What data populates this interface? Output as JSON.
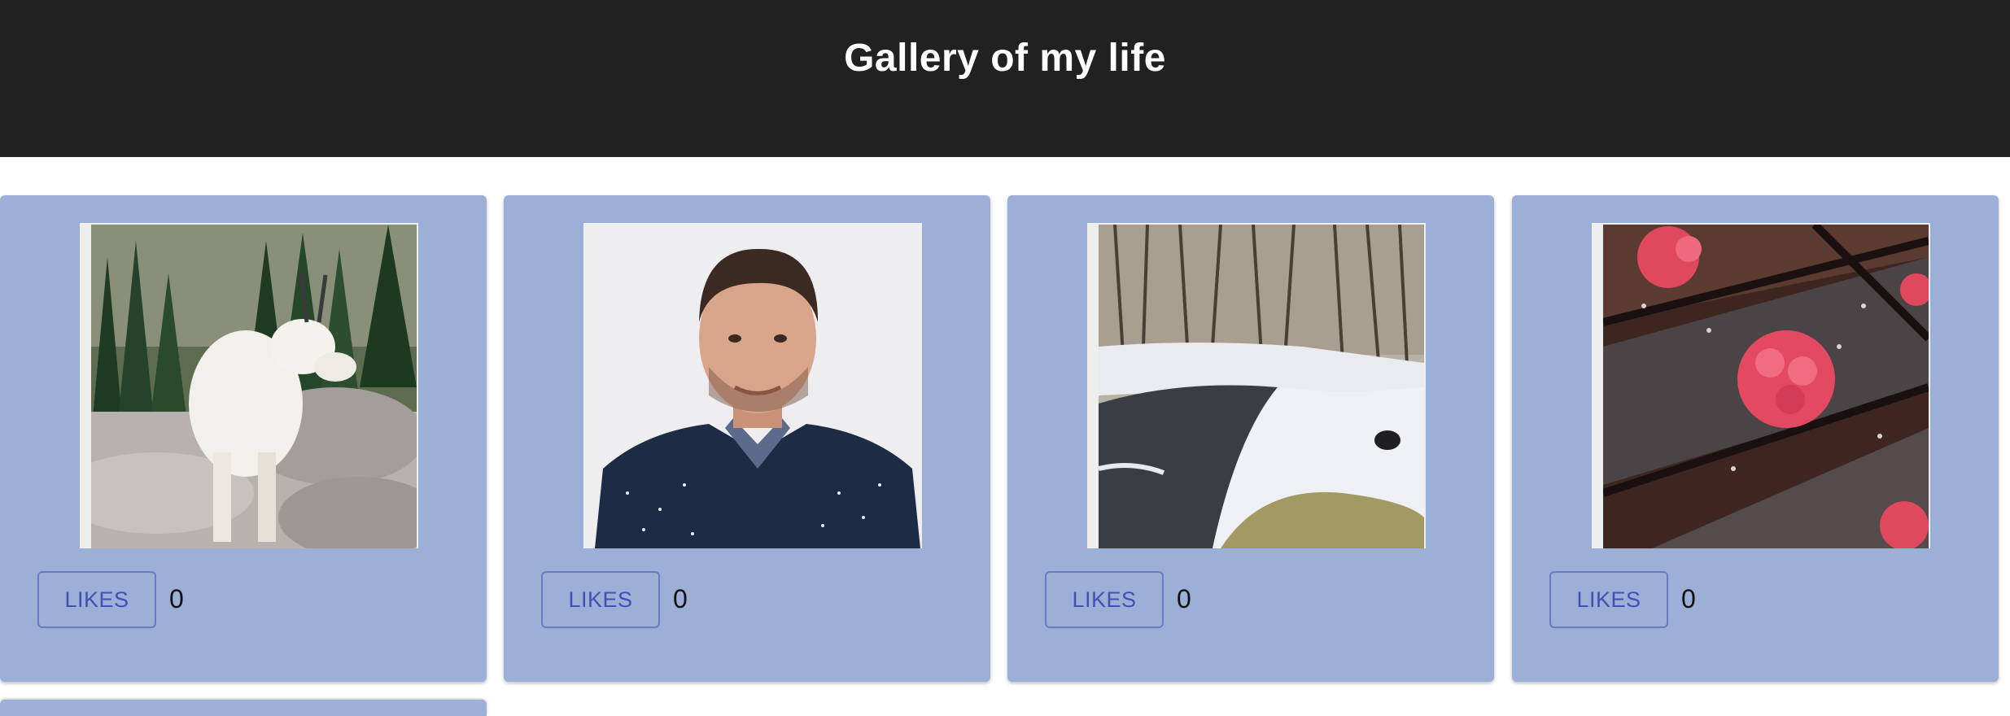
{
  "header": {
    "title": "Gallery of my life"
  },
  "cards": [
    {
      "image": "mountain-goat-photo",
      "likes_label": "LIKES",
      "likes_count": "0"
    },
    {
      "image": "man-portrait-photo",
      "likes_label": "LIKES",
      "likes_count": "0"
    },
    {
      "image": "snowy-creek-photo",
      "likes_label": "LIKES",
      "likes_count": "0"
    },
    {
      "image": "raspberry-chocolate-photo",
      "likes_label": "LIKES",
      "likes_count": "0"
    }
  ],
  "colors": {
    "header_bg": "#212121",
    "card_bg": "#9cafd6",
    "button_text": "#3f51b5"
  }
}
